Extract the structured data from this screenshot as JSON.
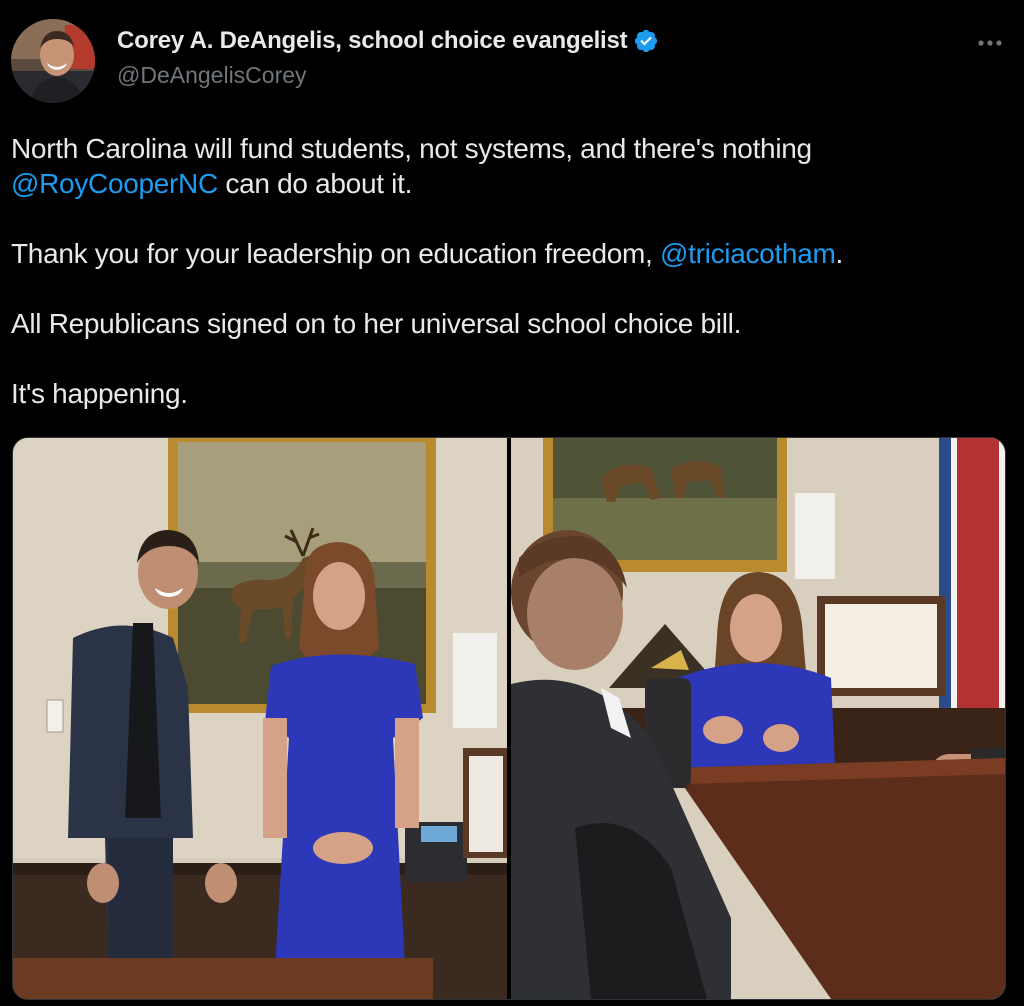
{
  "tweet": {
    "author": {
      "display_name": "Corey A. DeAngelis, school choice evangelist",
      "handle": "@DeAngelisCorey",
      "verified": true,
      "avatar_icon": "avatar-photo"
    },
    "more_icon": "more-horizontal-icon",
    "text": {
      "line1_text": "North Carolina will fund students, not systems, and there's nothing ",
      "line1_mention": "@RoyCooperNC",
      "line1_tail": " can do about it.",
      "line2_text": "Thank you for your leadership on education freedom, ",
      "line2_mention": "@triciacotham",
      "line2_tail": ".",
      "line3": "All Republicans signed on to her universal school choice bill.",
      "line4": "It's happening."
    },
    "media": [
      {
        "label": "photo-two-people-standing-office"
      },
      {
        "label": "photo-meeting-at-conference-table"
      }
    ],
    "colors": {
      "background": "#000000",
      "text": "#e7e9ea",
      "secondary": "#71767b",
      "link": "#1d9bf0",
      "verified": "#1d9bf0"
    }
  }
}
